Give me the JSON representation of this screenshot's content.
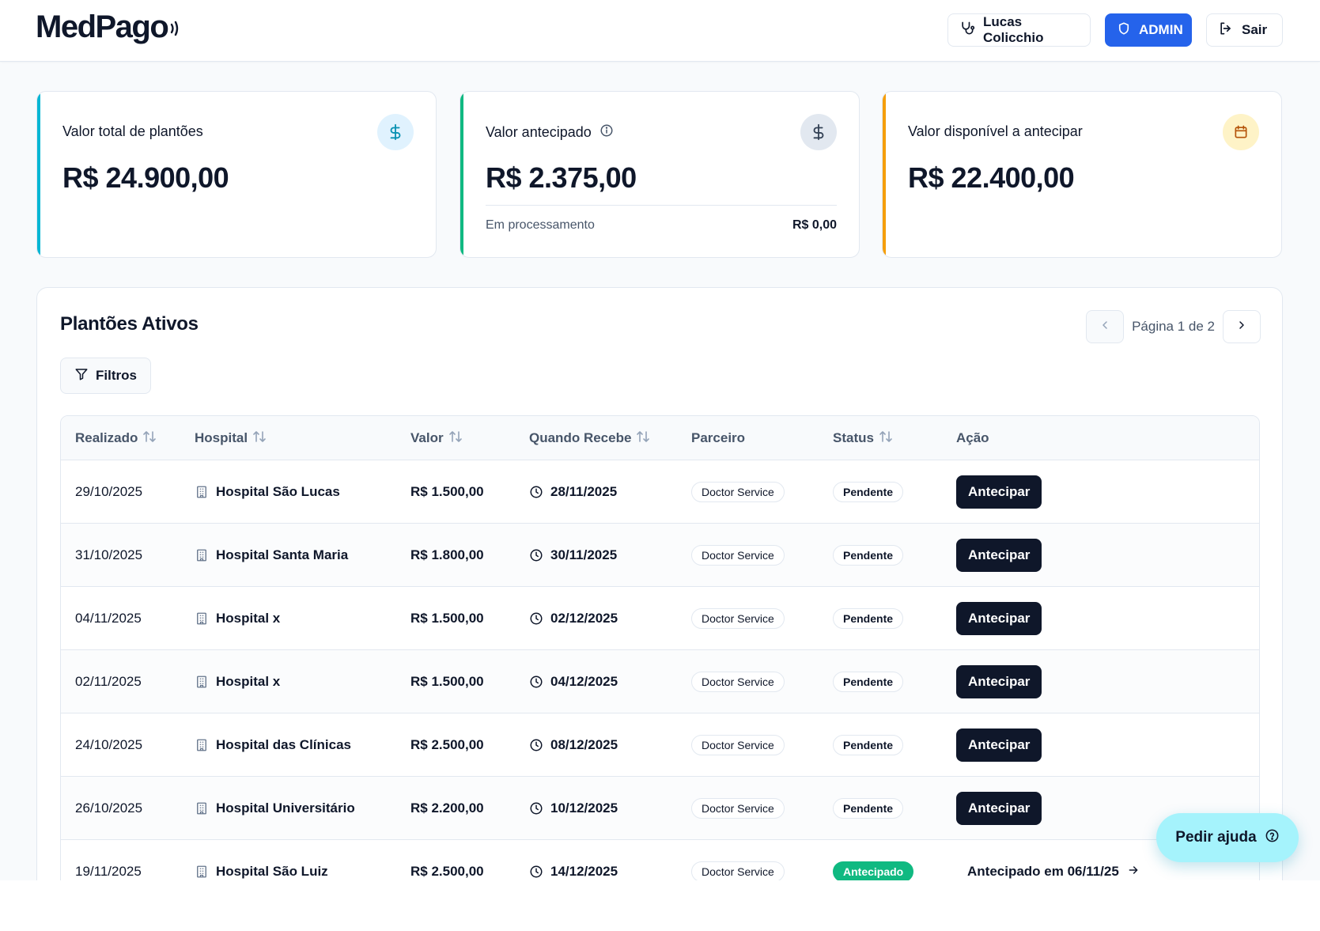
{
  "app": {
    "logo": "MedPago"
  },
  "header": {
    "user_label": "Lucas Colicchio",
    "admin_label": "ADMIN",
    "logout_label": "Sair"
  },
  "cards": [
    {
      "title": "Valor total de plantões",
      "value": "R$ 24.900,00",
      "icon": "dollar-icon",
      "accent": "#06b6d4"
    },
    {
      "title": "Valor antecipado",
      "value": "R$ 2.375,00",
      "icon": "dollar-icon",
      "accent": "#10b981",
      "sub_label": "Em processamento",
      "sub_value": "R$ 0,00"
    },
    {
      "title": "Valor disponível a antecipar",
      "value": "R$ 22.400,00",
      "icon": "calendar-icon",
      "accent": "#f59e0b"
    }
  ],
  "panel": {
    "title": "Plantões Ativos",
    "page_text": "Página 1 de 2",
    "filter_label": "Filtros"
  },
  "table": {
    "headers": [
      "Realizado",
      "Hospital",
      "Valor",
      "Quando Recebe",
      "Parceiro",
      "Status",
      "Ação"
    ],
    "rows": [
      {
        "realizado": "29/10/2025",
        "hospital": "Hospital São Lucas",
        "valor": "R$ 1.500,00",
        "recebe": "28/11/2025",
        "parceiro": "Doctor Service",
        "status": "Pendente",
        "acao": "Antecipar"
      },
      {
        "realizado": "31/10/2025",
        "hospital": "Hospital Santa Maria",
        "valor": "R$ 1.800,00",
        "recebe": "30/11/2025",
        "parceiro": "Doctor Service",
        "status": "Pendente",
        "acao": "Antecipar"
      },
      {
        "realizado": "04/11/2025",
        "hospital": "Hospital x",
        "valor": "R$ 1.500,00",
        "recebe": "02/12/2025",
        "parceiro": "Doctor Service",
        "status": "Pendente",
        "acao": "Antecipar"
      },
      {
        "realizado": "02/11/2025",
        "hospital": "Hospital x",
        "valor": "R$ 1.500,00",
        "recebe": "04/12/2025",
        "parceiro": "Doctor Service",
        "status": "Pendente",
        "acao": "Antecipar"
      },
      {
        "realizado": "24/10/2025",
        "hospital": "Hospital das Clínicas",
        "valor": "R$ 2.500,00",
        "recebe": "08/12/2025",
        "parceiro": "Doctor Service",
        "status": "Pendente",
        "acao": "Antecipar"
      },
      {
        "realizado": "26/10/2025",
        "hospital": "Hospital Universitário",
        "valor": "R$ 2.200,00",
        "recebe": "10/12/2025",
        "parceiro": "Doctor Service",
        "status": "Pendente",
        "acao": "Antecipar"
      },
      {
        "realizado": "19/11/2025",
        "hospital": "Hospital São Luiz",
        "valor": "R$ 2.500,00",
        "recebe": "14/12/2025",
        "parceiro": "Doctor Service",
        "status": "Antecipado",
        "acao": "Antecipado em 06/11/25"
      }
    ]
  },
  "help": {
    "label": "Pedir ajuda"
  },
  "colors": {
    "primary": "#2563eb",
    "dark": "#0f172a",
    "success": "#10b981",
    "help_bg": "#a5f3fc"
  }
}
